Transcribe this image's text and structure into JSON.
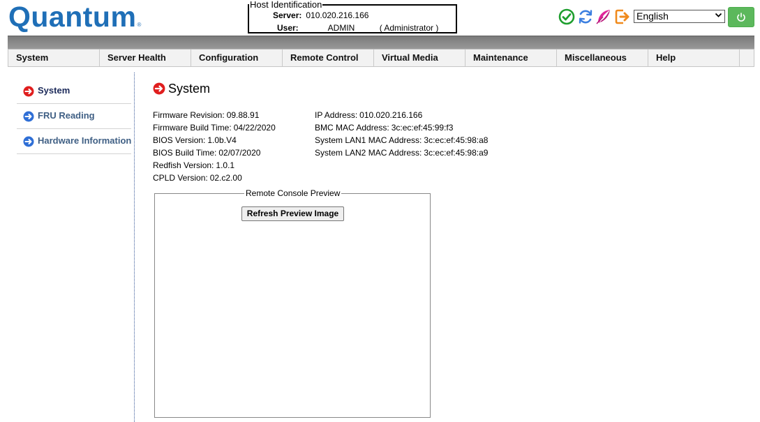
{
  "brand": {
    "name": "Quantum",
    "registered": "®",
    "color": "#1f6fb7"
  },
  "host": {
    "legend": "Host Identification",
    "server_label": "Server:",
    "server_value": "010.020.216.166",
    "user_label": "User:",
    "user_value": "ADMIN",
    "user_role": "( Administrator )"
  },
  "toolbar": {
    "icons": [
      "check-circle-icon",
      "refresh-icon",
      "feather-icon",
      "logout-icon"
    ],
    "language": "English",
    "power_icon": "power-icon"
  },
  "menu": [
    {
      "label": "System"
    },
    {
      "label": "Server Health"
    },
    {
      "label": "Configuration"
    },
    {
      "label": "Remote Control"
    },
    {
      "label": "Virtual Media"
    },
    {
      "label": "Maintenance"
    },
    {
      "label": "Miscellaneous"
    },
    {
      "label": "Help"
    }
  ],
  "sidebar": {
    "items": [
      {
        "label": "System",
        "active": true
      },
      {
        "label": "FRU Reading",
        "active": false
      },
      {
        "label": "Hardware Information",
        "active": false
      }
    ]
  },
  "page": {
    "title": "System",
    "left_info": [
      {
        "label": "Firmware Revision:",
        "value": "09.88.91"
      },
      {
        "label": "Firmware Build Time:",
        "value": "04/22/2020"
      },
      {
        "label": "BIOS Version:",
        "value": "1.0b.V4"
      },
      {
        "label": "BIOS Build Time:",
        "value": "02/07/2020"
      },
      {
        "label": "Redfish Version:",
        "value": "1.0.1"
      },
      {
        "label": "CPLD Version:",
        "value": "02.c2.00"
      }
    ],
    "right_info": [
      {
        "label": "IP Address:",
        "value": "010.020.216.166"
      },
      {
        "label": "BMC MAC Address:",
        "value": "3c:ec:ef:45:99:f3"
      },
      {
        "label": "System LAN1 MAC Address:",
        "value": "3c:ec:ef:45:98:a8"
      },
      {
        "label": "System LAN2 MAC Address:",
        "value": "3c:ec:ef:45:98:a9"
      }
    ],
    "console_legend": "Remote Console Preview",
    "refresh_button": "Refresh Preview Image"
  }
}
